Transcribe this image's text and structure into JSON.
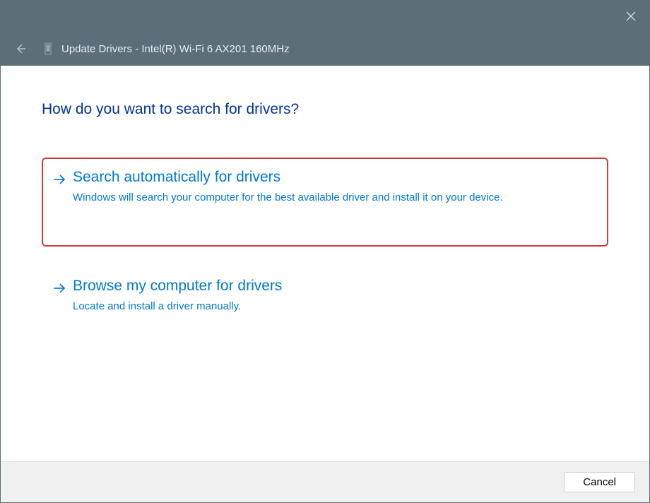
{
  "window": {
    "title": "Update Drivers - Intel(R) Wi-Fi 6 AX201 160MHz"
  },
  "main": {
    "heading": "How do you want to search for drivers?",
    "options": [
      {
        "title": "Search automatically for drivers",
        "description": "Windows will search your computer for the best available driver and install it on your device."
      },
      {
        "title": "Browse my computer for drivers",
        "description": "Locate and install a driver manually."
      }
    ]
  },
  "footer": {
    "cancel_label": "Cancel"
  }
}
